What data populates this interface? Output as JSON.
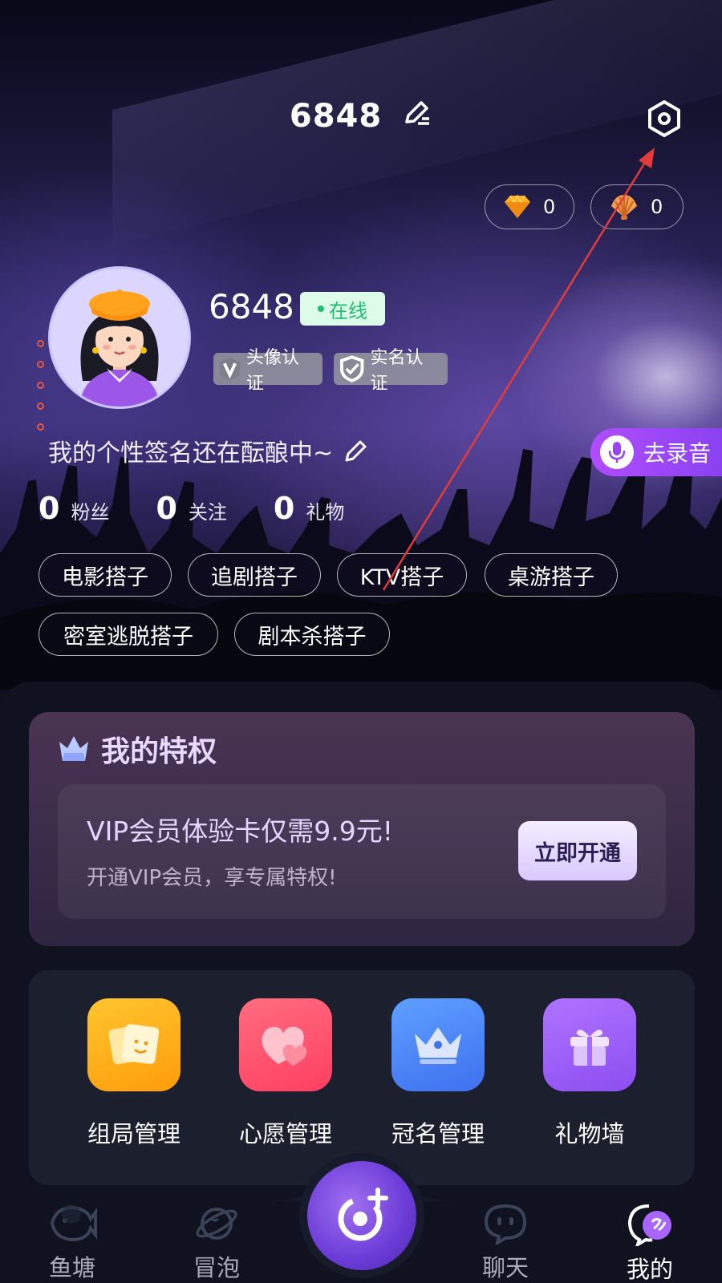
{
  "header": {
    "title": "6848"
  },
  "currency": {
    "diamond_count": "0",
    "shell_count": "0"
  },
  "profile": {
    "username": "6848",
    "status": "在线",
    "badges": [
      "头像认证",
      "实名认证"
    ],
    "signature": "我的个性签名还在酝酿中~",
    "record_label": "去录音"
  },
  "stats": [
    {
      "value": "0",
      "label": "粉丝"
    },
    {
      "value": "0",
      "label": "关注"
    },
    {
      "value": "0",
      "label": "礼物"
    }
  ],
  "tags": [
    "电影搭子",
    "追剧搭子",
    "KTV搭子",
    "桌游搭子",
    "密室逃脱搭子",
    "剧本杀搭子"
  ],
  "privilege": {
    "title": "我的特权",
    "vip_title": "VIP会员体验卡仅需9.9元!",
    "vip_subtitle": "开通VIP会员，享专属特权!",
    "vip_button": "立即开通"
  },
  "tools": [
    {
      "label": "组局管理",
      "icon": "party-card-icon",
      "color": "#ffb51f"
    },
    {
      "label": "心愿管理",
      "icon": "heart-icon",
      "color": "#ff5470"
    },
    {
      "label": "冠名管理",
      "icon": "crown-icon",
      "color": "#4f8cff"
    },
    {
      "label": "礼物墙",
      "icon": "gift-icon",
      "color": "#9b5cf2"
    }
  ],
  "nav": {
    "items": [
      {
        "label": "鱼塘",
        "icon": "fish-icon"
      },
      {
        "label": "冒泡",
        "icon": "planet-icon"
      },
      {
        "label": "聊天",
        "icon": "chat-icon"
      },
      {
        "label": "我的",
        "icon": "me-icon"
      }
    ],
    "active": "我的"
  },
  "colors": {
    "accent": "#8a42f0",
    "online": "#1fbe6e",
    "annotation": "#e23b3b"
  }
}
